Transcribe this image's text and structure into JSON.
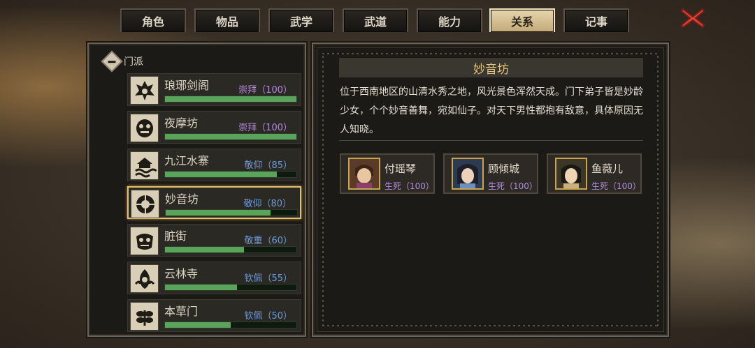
{
  "tabs": [
    "角色",
    "物品",
    "武学",
    "武道",
    "能力",
    "关系",
    "记事"
  ],
  "active_tab": "关系",
  "group": {
    "label": "门派",
    "expanded": true
  },
  "factions": [
    {
      "name": "琅琊剑阁",
      "relation": "崇拜（100）",
      "relation_color": "purple",
      "value": 100
    },
    {
      "name": "夜摩坊",
      "relation": "崇拜（100）",
      "relation_color": "purple",
      "value": 100
    },
    {
      "name": "九江水寨",
      "relation": "敬仰（85）",
      "relation_color": "blue",
      "value": 85
    },
    {
      "name": "妙音坊",
      "relation": "敬仰（80）",
      "relation_color": "blue",
      "value": 80,
      "selected": true
    },
    {
      "name": "脏街",
      "relation": "敬重（60）",
      "relation_color": "blue",
      "value": 60
    },
    {
      "name": "云林寺",
      "relation": "钦佩（55）",
      "relation_color": "blue",
      "value": 55
    },
    {
      "name": "本草门",
      "relation": "钦佩（50）",
      "relation_color": "blue",
      "value": 50
    }
  ],
  "detail": {
    "title": "妙音坊",
    "description": "位于西南地区的山清水秀之地，风光景色浑然天成。门下弟子皆是妙龄少女，个个妙音善舞，宛如仙子。对天下男性都抱有敌意，具体原因无人知晓。",
    "members": [
      {
        "name": "付瑶琴",
        "relation": "生死（100）"
      },
      {
        "name": "顾倾城",
        "relation": "生死（100）"
      },
      {
        "name": "鱼薇儿",
        "relation": "生死（100）"
      }
    ]
  },
  "colors": {
    "accent_gold": "#e3c57b",
    "bar_green": "#5aa35a",
    "relation_purple": "#b688e0",
    "relation_blue": "#6f9bd8",
    "close_red": "#d9473b"
  },
  "icons": {
    "close": "close-x-icon",
    "collapse": "minus-diamond-icon"
  }
}
